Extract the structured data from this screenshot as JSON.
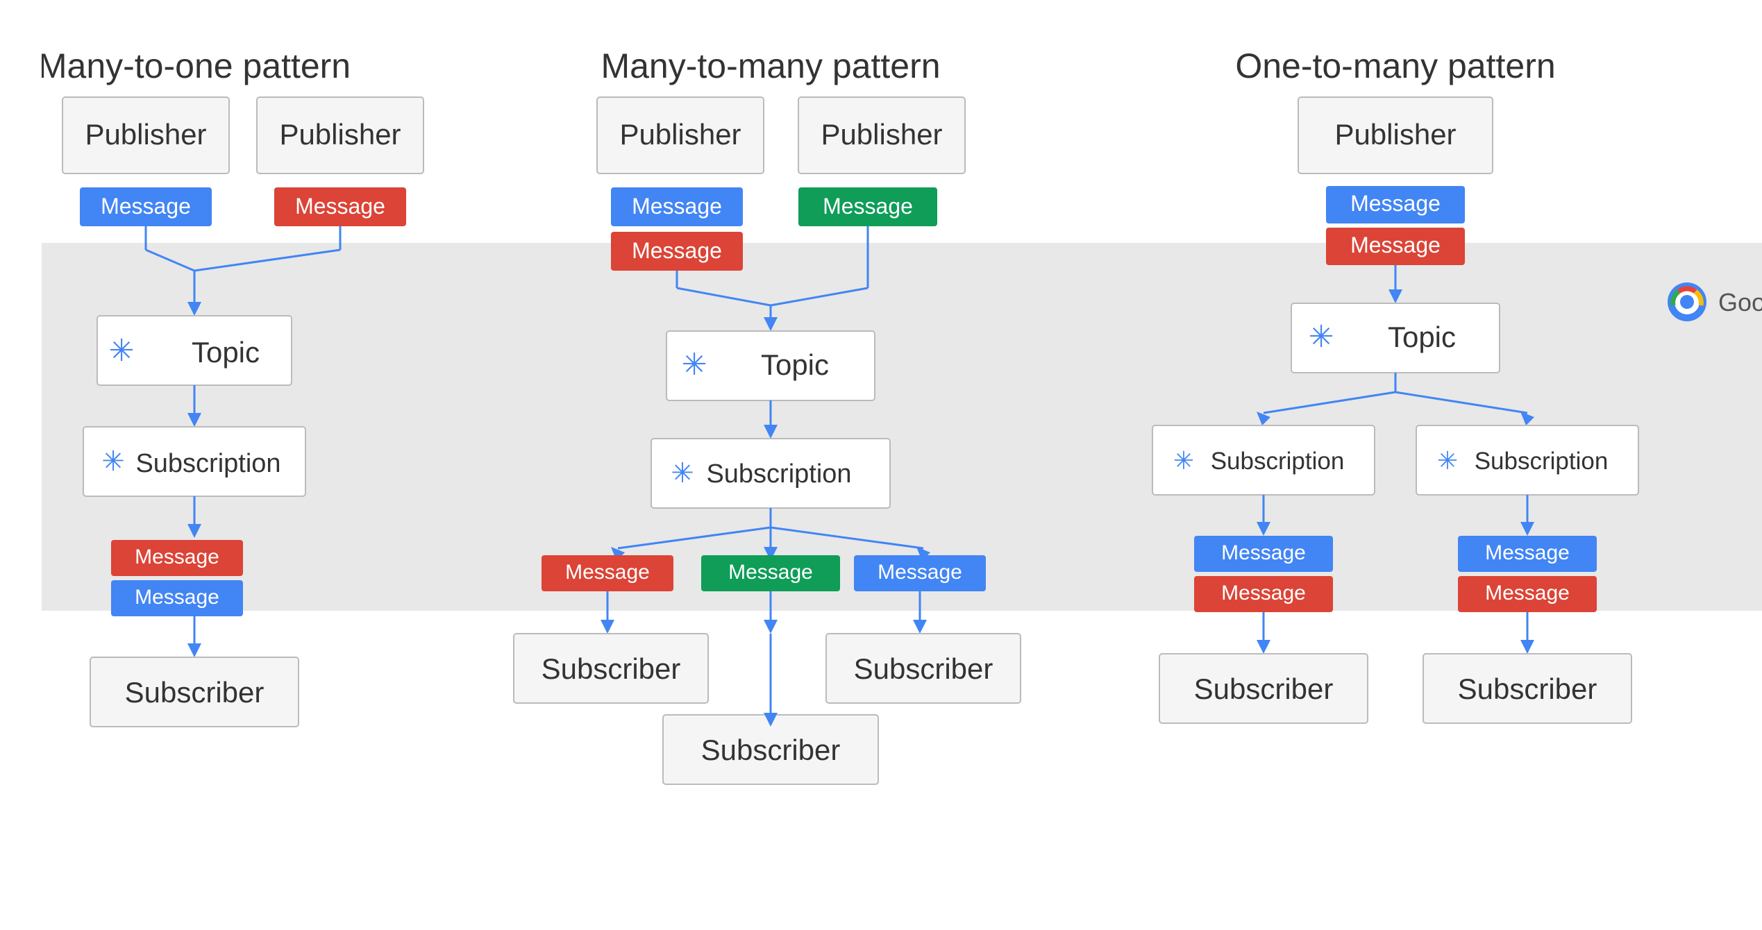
{
  "patterns": [
    {
      "id": "many-to-one",
      "title": "Many-to-one pattern",
      "publishers": [
        "Publisher",
        "Publisher"
      ],
      "messages_top": [
        {
          "color": "blue",
          "label": "Message"
        },
        {
          "color": "red",
          "label": "Message"
        }
      ],
      "topic": "Topic",
      "subscription": "Subscription",
      "messages_bottom": [
        {
          "color": "red",
          "label": "Message"
        },
        {
          "color": "blue",
          "label": "Message"
        }
      ],
      "subscribers": [
        "Subscriber"
      ]
    },
    {
      "id": "many-to-many",
      "title": "Many-to-many  pattern",
      "publishers": [
        "Publisher",
        "Publisher"
      ],
      "messages_top": [
        {
          "color": "blue",
          "label": "Message"
        },
        {
          "color": "red",
          "label": "Message"
        },
        {
          "color": "green",
          "label": "Message"
        }
      ],
      "topic": "Topic",
      "subscription": "Subscription",
      "messages_bottom": [
        {
          "color": "red",
          "label": "Message"
        },
        {
          "color": "blue",
          "label": "Message"
        },
        {
          "color": "green",
          "label": "Message"
        }
      ],
      "subscribers": [
        "Subscriber",
        "Subscriber",
        "Subscriber"
      ]
    },
    {
      "id": "one-to-many",
      "title": "One-to-many pattern",
      "publishers": [
        "Publisher"
      ],
      "messages_top": [
        {
          "color": "blue",
          "label": "Message"
        },
        {
          "color": "red",
          "label": "Message"
        }
      ],
      "topic": "Topic",
      "subscriptions": [
        "Subscription",
        "Subscription"
      ],
      "messages_bottom_left": [
        {
          "color": "blue",
          "label": "Message"
        },
        {
          "color": "red",
          "label": "Message"
        }
      ],
      "messages_bottom_right": [
        {
          "color": "blue",
          "label": "Message"
        },
        {
          "color": "red",
          "label": "Message"
        }
      ],
      "subscribers": [
        "Subscriber",
        "Subscriber"
      ]
    }
  ],
  "google_cloud": {
    "label": "Google Cloud"
  },
  "message_label": "Message"
}
